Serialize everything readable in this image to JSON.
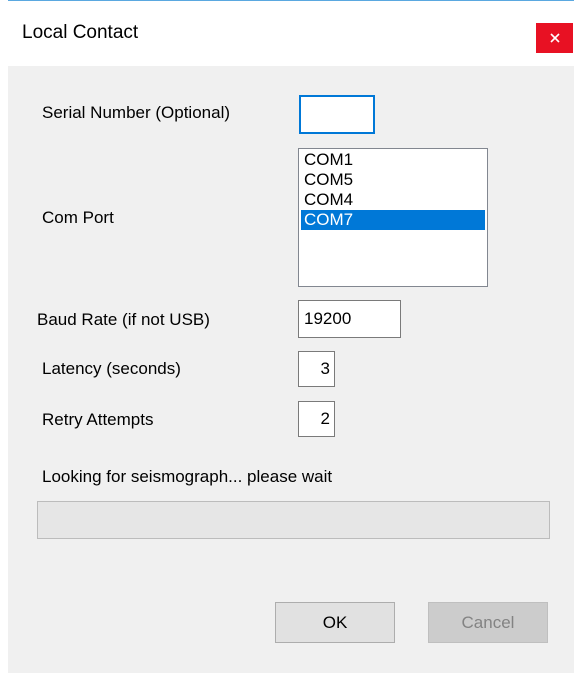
{
  "window": {
    "title": "Local Contact",
    "close_icon": "close-icon",
    "colors": {
      "close_bg": "#e81123",
      "accent": "#0078d7",
      "client_bg": "#f0f0f0"
    }
  },
  "form": {
    "serial_number": {
      "label": "Serial Number (Optional)",
      "value": ""
    },
    "com_port": {
      "label": "Com Port",
      "options": [
        "COM1",
        "COM5",
        "COM4",
        "COM7"
      ],
      "selected": "COM7"
    },
    "baud_rate": {
      "label": "Baud Rate (if not USB)",
      "value": "19200"
    },
    "latency": {
      "label": "Latency (seconds)",
      "value": "3"
    },
    "retry": {
      "label": "Retry Attempts",
      "value": "2"
    }
  },
  "status": {
    "text": "Looking for seismograph... please wait",
    "progress": 0
  },
  "buttons": {
    "ok": "OK",
    "cancel": "Cancel"
  }
}
